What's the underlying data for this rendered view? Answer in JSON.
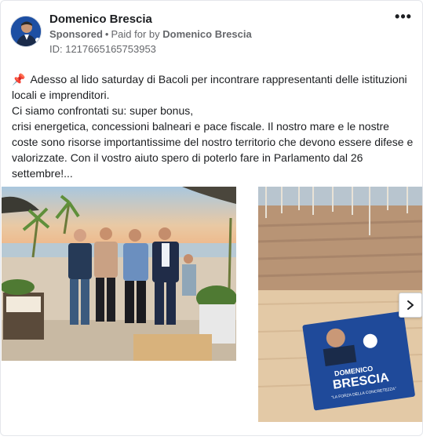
{
  "post": {
    "author": "Domenico Brescia",
    "sponsored": "Sponsored",
    "separator": "•",
    "paid_for_prefix": "Paid for by",
    "paid_for_by": "Domenico Brescia",
    "ad_id": "ID: 1217665165753953",
    "more_label": "•••",
    "pin_icon": "📌",
    "body": "Adesso al lido saturday di Bacoli per incontrare rappresentanti delle istituzioni locali e imprenditori.\nCi siamo confrontati su: super bonus,\ncrisi energetica, concessioni balneari e pace fiscale. Il nostro mare e le nostre coste sono risorse importantissime del nostro territorio che devono essere difese e valorizzate. Con il vostro aiuto spero di poterlo fare in Parlamento dal 26 settembre!..."
  },
  "carousel": {
    "flyer_name": "DOMENICO",
    "flyer_surname": "BRESCIA",
    "flyer_slogan": "\"LA FORZA DELLA CONCRETEZZA\""
  },
  "colors": {
    "accent": "#1d4fa3",
    "text": "#1c1e21",
    "muted": "#65676b"
  },
  "icons": {
    "more": "more-options-icon",
    "next": "chevron-right-icon",
    "pin": "pin-icon"
  }
}
